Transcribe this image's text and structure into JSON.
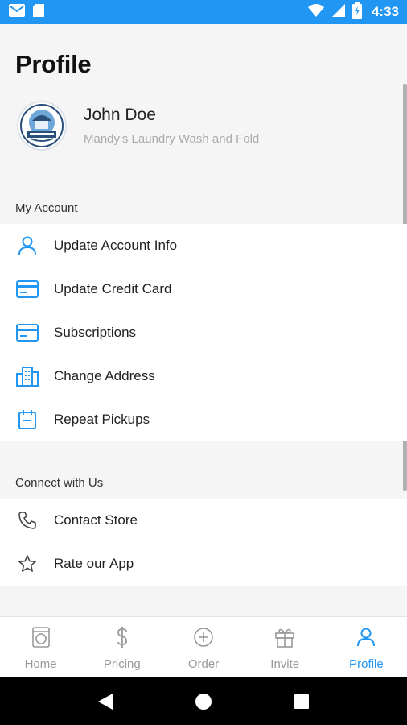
{
  "status_bar": {
    "time": "4:33",
    "icons": [
      "gmail-icon",
      "sd-card-icon",
      "wifi-icon",
      "signal-icon",
      "battery-icon"
    ],
    "color": "#2196f3"
  },
  "header": {
    "title": "Profile"
  },
  "profile": {
    "name": "John Doe",
    "store": "Mandy's Laundry Wash and Fold"
  },
  "my_account": {
    "title": "My Account",
    "items": [
      {
        "label": "Update Account Info",
        "icon": "user-icon"
      },
      {
        "label": "Update Credit Card",
        "icon": "credit-card-icon"
      },
      {
        "label": "Subscriptions",
        "icon": "credit-card-icon"
      },
      {
        "label": "Change Address",
        "icon": "building-icon"
      },
      {
        "label": "Repeat Pickups",
        "icon": "calendar-icon"
      }
    ]
  },
  "connect": {
    "title": "Connect with Us",
    "items": [
      {
        "label": "Contact Store",
        "icon": "phone-icon"
      },
      {
        "label": "Rate our App",
        "icon": "star-icon"
      }
    ]
  },
  "tabs": [
    {
      "label": "Home",
      "icon": "washer-icon",
      "active": false
    },
    {
      "label": "Pricing",
      "icon": "dollar-icon",
      "active": false
    },
    {
      "label": "Order",
      "icon": "plus-circle-icon",
      "active": false
    },
    {
      "label": "Invite",
      "icon": "gift-icon",
      "active": false
    },
    {
      "label": "Profile",
      "icon": "user-icon",
      "active": true
    }
  ],
  "colors": {
    "accent": "#2196f3",
    "inactive": "#999999"
  }
}
